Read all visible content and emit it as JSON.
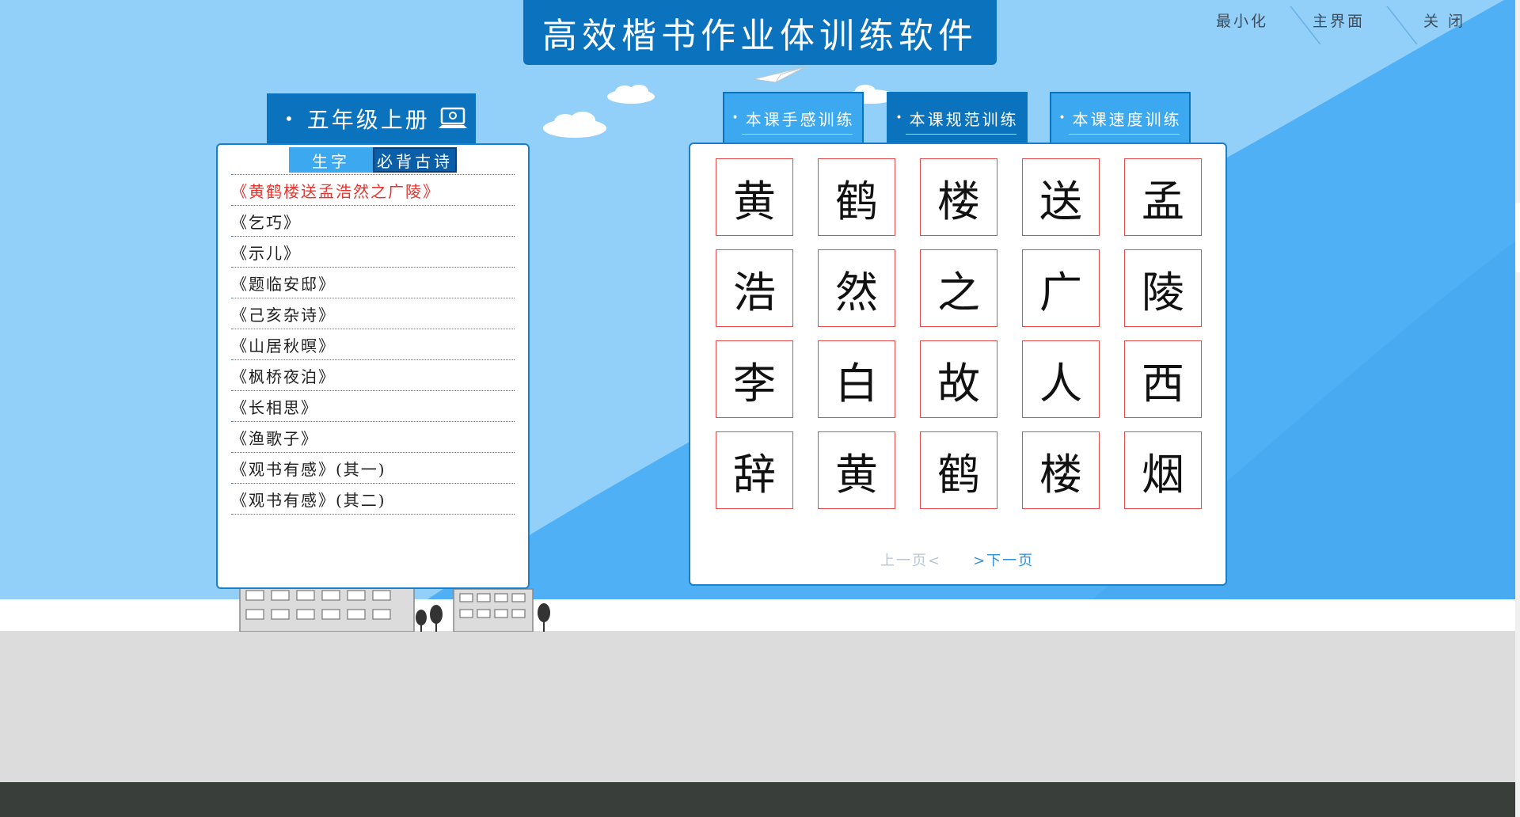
{
  "app": {
    "title": "高效楷书作业体训练软件"
  },
  "window_controls": {
    "minimize": "最小化",
    "home": "主界面",
    "close": "关 闭"
  },
  "grade": {
    "label": "五年级上册",
    "icon": "computer-icon"
  },
  "sub_tabs": [
    {
      "label": "生字"
    },
    {
      "label": "必背古诗"
    }
  ],
  "poems": [
    "《黄鹤楼送孟浩然之广陵》",
    "《乞巧》",
    "《示儿》",
    "《题临安邸》",
    "《己亥杂诗》",
    "《山居秋暝》",
    "《枫桥夜泊》",
    "《长相思》",
    "《渔歌子》",
    "《观书有感》(其一)",
    "《观书有感》(其二)"
  ],
  "training_tabs": [
    "本课手感训练",
    "本课规范训练",
    "本课速度训练"
  ],
  "characters": [
    "黄",
    "鹤",
    "楼",
    "送",
    "孟",
    "浩",
    "然",
    "之",
    "广",
    "陵",
    "李",
    "白",
    "故",
    "人",
    "西",
    "辞",
    "黄",
    "鹤",
    "楼",
    "烟"
  ],
  "pager": {
    "prev": "上一页<",
    "next": ">下一页"
  },
  "colors": {
    "primary": "#0b73bd",
    "accent": "#3ba8f0",
    "active_item": "#e8342e",
    "cell_border": "#e44c4c"
  }
}
